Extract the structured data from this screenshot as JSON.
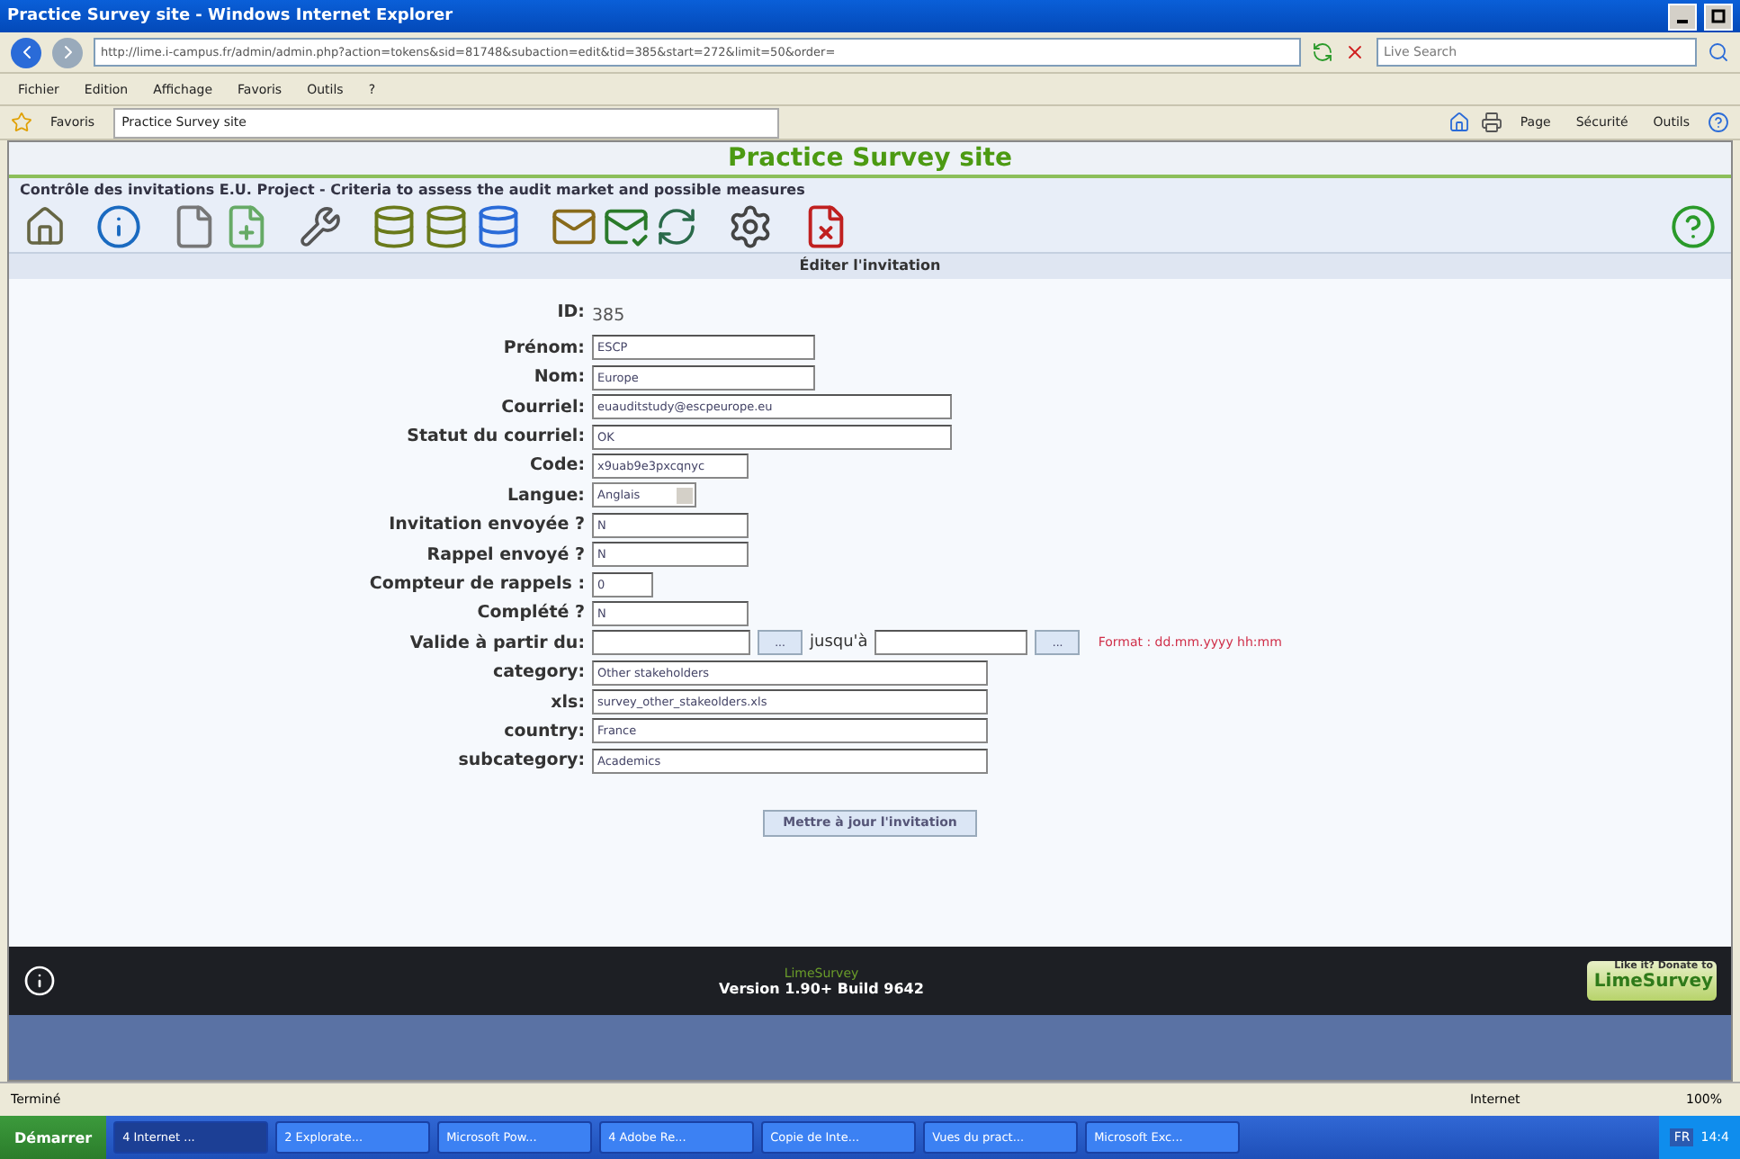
{
  "window": {
    "title": "Practice Survey site - Windows Internet Explorer"
  },
  "address": {
    "url": "http://lime.i-campus.fr/admin/admin.php?action=tokens&sid=81748&subaction=edit&tid=385&start=272&limit=50&order="
  },
  "search": {
    "placeholder": "Live Search"
  },
  "menu": [
    "Fichier",
    "Edition",
    "Affichage",
    "Favoris",
    "Outils",
    "?"
  ],
  "favorites": {
    "label": "Favoris",
    "tab": "Practice Survey site"
  },
  "command_bar": [
    "Page",
    "Sécurité",
    "Outils"
  ],
  "site": {
    "title": "Practice Survey site",
    "subtitle": "Contrôle des invitations E.U. Project - Criteria to assess the audit market and possible measures"
  },
  "form": {
    "header": "Éditer l'invitation",
    "fields": [
      {
        "kind": "static",
        "label": "ID:",
        "value": "385"
      },
      {
        "kind": "text",
        "label": "Prénom:",
        "value": "ESCP"
      },
      {
        "kind": "text",
        "label": "Nom:",
        "value": "Europe"
      },
      {
        "kind": "wide",
        "label": "Courriel:",
        "value": "euauditstudy@escpeurope.eu"
      },
      {
        "kind": "wide",
        "label": "Statut du courriel:",
        "value": "OK"
      },
      {
        "kind": "short",
        "label": "Code:",
        "value": "x9uab9e3pxcqnyc"
      },
      {
        "kind": "select",
        "label": "Langue:",
        "value": "Anglais"
      },
      {
        "kind": "short",
        "label": "Invitation envoyée ?",
        "value": "N"
      },
      {
        "kind": "short",
        "label": "Rappel envoyé ?",
        "value": "N"
      },
      {
        "kind": "tiny",
        "label": "Compteur de rappels :",
        "value": "0"
      },
      {
        "kind": "short",
        "label": "Complété ?",
        "value": "N"
      },
      {
        "kind": "date",
        "label": "Valide à partir du:",
        "picker": "...",
        "until": "jusqu'à",
        "format": "Format : dd.mm.yyyy hh:mm"
      },
      {
        "kind": "long",
        "label": "category:",
        "value": "Other stakeholders"
      },
      {
        "kind": "long",
        "label": "xls:",
        "value": "survey_other_stakeolders.xls"
      },
      {
        "kind": "long",
        "label": "country:",
        "value": "France"
      },
      {
        "kind": "long",
        "label": "subcategory:",
        "value": "Academics"
      }
    ],
    "submit": "Mettre à jour l'invitation"
  },
  "footer": {
    "brand": "LimeSurvey",
    "version": "Version 1.90+ Build 9642",
    "donate_top": "Like it? Donate to",
    "donate_brand": "LimeSurvey"
  },
  "status_bar": {
    "text": "Terminé",
    "zone": "Internet",
    "zoom": "100%"
  },
  "taskbar": {
    "start": "Démarrer",
    "tasks": [
      {
        "label": "4 Internet ...",
        "selected": true
      },
      {
        "label": "2 Explorate...",
        "selected": false
      },
      {
        "label": "Microsoft Pow...",
        "selected": false
      },
      {
        "label": "4 Adobe Re...",
        "selected": false
      },
      {
        "label": "Copie de Inte...",
        "selected": false
      },
      {
        "label": "Vues du pract...",
        "selected": false
      },
      {
        "label": "Microsoft Exc...",
        "selected": false
      }
    ],
    "language": "FR",
    "clock": "14:4"
  }
}
